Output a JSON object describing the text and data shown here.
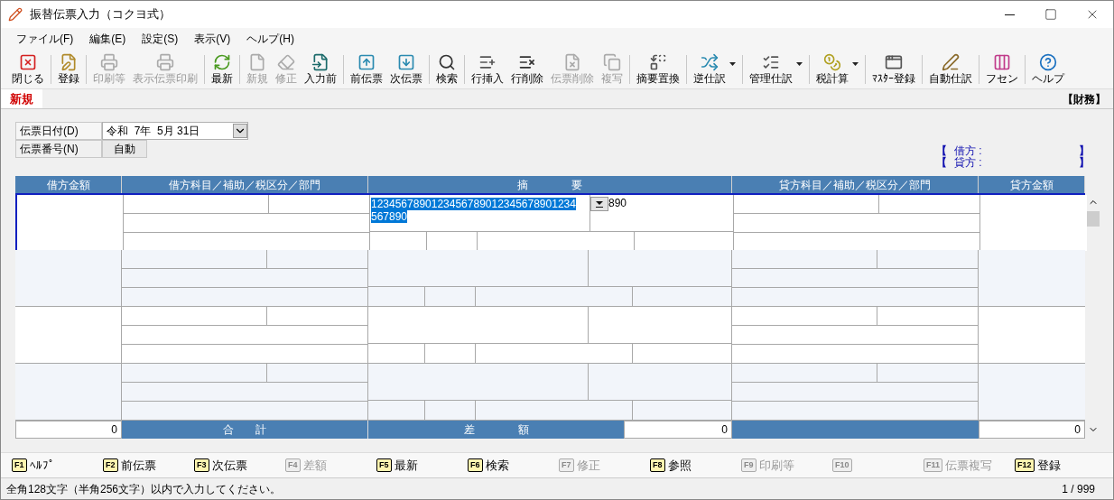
{
  "window": {
    "title": "振替伝票入力（コクヨ式）"
  },
  "menu": [
    "ファイル(F)",
    "編集(E)",
    "設定(S)",
    "表示(V)",
    "ヘルプ(H)"
  ],
  "toolbar": [
    [
      {
        "label": "閉じる",
        "disabled": false
      }
    ],
    [
      {
        "label": "登録",
        "disabled": false
      }
    ],
    [
      {
        "label": "印刷等",
        "disabled": true
      },
      {
        "label": "表示伝票印刷",
        "disabled": true
      }
    ],
    [
      {
        "label": "最新",
        "disabled": false
      }
    ],
    [
      {
        "label": "新規",
        "disabled": true
      },
      {
        "label": "修正",
        "disabled": true
      },
      {
        "label": "入力前",
        "disabled": false
      }
    ],
    [
      {
        "label": "前伝票",
        "disabled": false
      },
      {
        "label": "次伝票",
        "disabled": false
      }
    ],
    [
      {
        "label": "検索",
        "disabled": false
      }
    ],
    [
      {
        "label": "行挿入",
        "disabled": false
      },
      {
        "label": "行削除",
        "disabled": false
      },
      {
        "label": "伝票削除",
        "disabled": true
      },
      {
        "label": "複写",
        "disabled": true
      }
    ],
    [
      {
        "label": "摘要置換",
        "disabled": false
      }
    ],
    [
      {
        "label": "逆仕訳",
        "disabled": false,
        "dropdown": true
      }
    ],
    [
      {
        "label": "管理仕訳",
        "disabled": false,
        "dropdown": true
      }
    ],
    [
      {
        "label": "税計算",
        "disabled": false,
        "dropdown": true
      }
    ],
    [
      {
        "label": "ﾏｽﾀｰ登録",
        "disabled": false
      }
    ],
    [
      {
        "label": "自動仕訳",
        "disabled": false
      }
    ],
    [
      {
        "label": "フセン",
        "disabled": false
      }
    ],
    [
      {
        "label": "ヘルプ",
        "disabled": false
      }
    ]
  ],
  "tab": {
    "label": "新規",
    "context": "【財務】"
  },
  "form": {
    "date_label": "伝票日付(D)",
    "date_value": "令和  7年  5月 31日",
    "number_label": "伝票番号(N)",
    "number_button": "自動"
  },
  "balance": [
    {
      "open": "【",
      "label": "借方 :",
      "close": "】"
    },
    {
      "open": "【",
      "label": "貸方 :",
      "close": "】"
    }
  ],
  "table": {
    "columns": [
      "借方金額",
      "借方科目／補助／税区分／部門",
      "摘　　　　要",
      "貸方科目／補助／税区分／部門",
      "貸方金額"
    ],
    "rows": [
      {
        "selected": true,
        "summary_lines": [
          "1234567890123456789012345678901234",
          "567890"
        ],
        "summary_text_selected": true,
        "summary_overflow": "890"
      },
      {
        "selected": false
      },
      {
        "selected": false
      },
      {
        "selected": false
      }
    ],
    "totals": {
      "debit_total": "0",
      "total_label": "合　　計",
      "difference_label": "差　　　　額",
      "difference": "0",
      "credit_total": "0"
    }
  },
  "function_keys": [
    {
      "key": "F1",
      "label": "ﾍﾙﾌﾟ",
      "disabled": false
    },
    {
      "key": "F2",
      "label": "前伝票",
      "disabled": false
    },
    {
      "key": "F3",
      "label": "次伝票",
      "disabled": false
    },
    {
      "key": "F4",
      "label": "差額",
      "disabled": true
    },
    {
      "key": "F5",
      "label": "最新",
      "disabled": false
    },
    {
      "key": "F6",
      "label": "検索",
      "disabled": false
    },
    {
      "key": "F7",
      "label": "修正",
      "disabled": true
    },
    {
      "key": "F8",
      "label": "参照",
      "disabled": false
    },
    {
      "key": "F9",
      "label": "印刷等",
      "disabled": true
    },
    {
      "key": "F10",
      "disabled": true
    },
    {
      "key": "F11",
      "label": "伝票複写",
      "disabled": true
    },
    {
      "key": "F12",
      "label": "登録",
      "disabled": false
    }
  ],
  "status_bar": {
    "message": "全角128文字（半角256文字）以内で入力してください。",
    "page": "1 / 999"
  }
}
